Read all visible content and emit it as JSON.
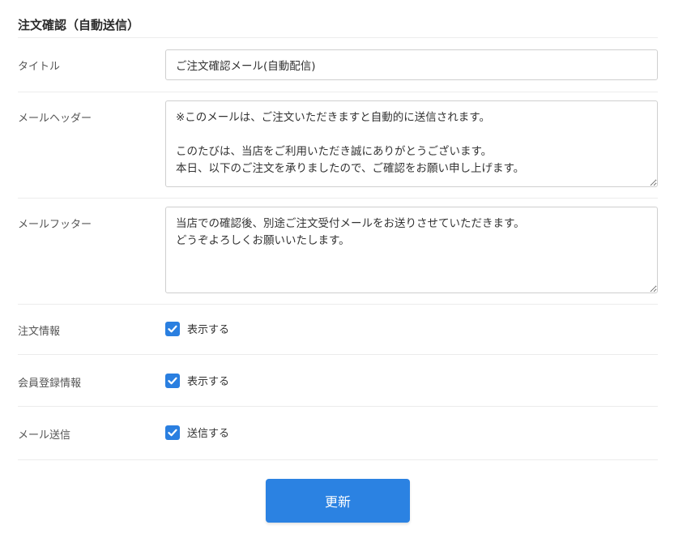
{
  "section": {
    "title": "注文確認（自動送信）"
  },
  "fields": {
    "title": {
      "label": "タイトル",
      "value": "ご注文確認メール(自動配信)"
    },
    "header": {
      "label": "メールヘッダー",
      "value": "※このメールは、ご注文いただきますと自動的に送信されます。\n\nこのたびは、当店をご利用いただき誠にありがとうございます。\n本日、以下のご注文を承りましたので、ご確認をお願い申し上げます。"
    },
    "footer": {
      "label": "メールフッター",
      "value": "当店での確認後、別途ご注文受付メールをお送りさせていただきます。\nどうぞよろしくお願いいたします。"
    }
  },
  "options": [
    {
      "label": "注文情報",
      "checkbox_label": "表示する",
      "checked": true
    },
    {
      "label": "会員登録情報",
      "checkbox_label": "表示する",
      "checked": true
    },
    {
      "label": "メール送信",
      "checkbox_label": "送信する",
      "checked": true
    }
  ],
  "submit": {
    "label": "更新"
  },
  "colors": {
    "accent": "#2b82e2",
    "checkbox": "#2a7fe0",
    "divider": "#ececec"
  }
}
